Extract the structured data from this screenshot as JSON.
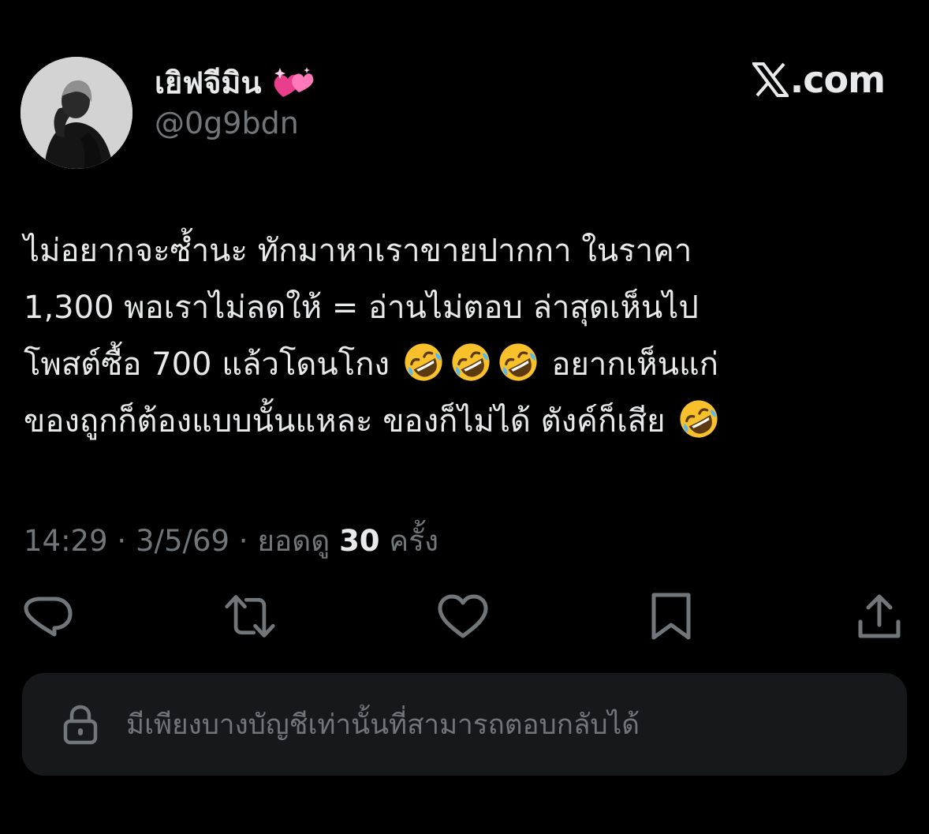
{
  "author": {
    "display_name": "เยิฟจีมิน",
    "handle": "@0g9bdn",
    "name_emoji": "sparkling-heart-icon"
  },
  "brand": {
    "domain": ".com",
    "logo": "x-logo-icon"
  },
  "post": {
    "lines": [
      "ไม่อยากจะซ้ำนะ ทักมาหาเราขายปากกา ในราคา",
      "1,300 พอเราไม่ลดให้ = อ่านไม่ตอบ   ล่าสุดเห็นไป",
      "โพสต์ซื้อ 700 แล้วโดนโกง",
      "อยากเห็นแก่",
      "ของถูกก็ต้องแบบนั้นแหละ ของก็ไม่ได้ ตังค์ก็เสีย"
    ],
    "emoji": "rolling-on-floor-laughing-icon"
  },
  "meta": {
    "time": "14:29",
    "separator": " · ",
    "date": "3/5/69",
    "views_label": "ยอดดู",
    "views_count": "30",
    "views_unit": "ครั้ง"
  },
  "actions": [
    "reply-icon",
    "repost-icon",
    "like-icon",
    "bookmark-icon",
    "share-icon"
  ],
  "reply_restriction": {
    "text": "มีเพียงบางบัญชีเท่านั้นที่สามารถตอบกลับได้",
    "icon": "lock-icon"
  },
  "colors": {
    "background": "#000000",
    "primary_text": "#e7e9ea",
    "secondary_text": "#71767b",
    "reply_bar": "#16181c"
  }
}
